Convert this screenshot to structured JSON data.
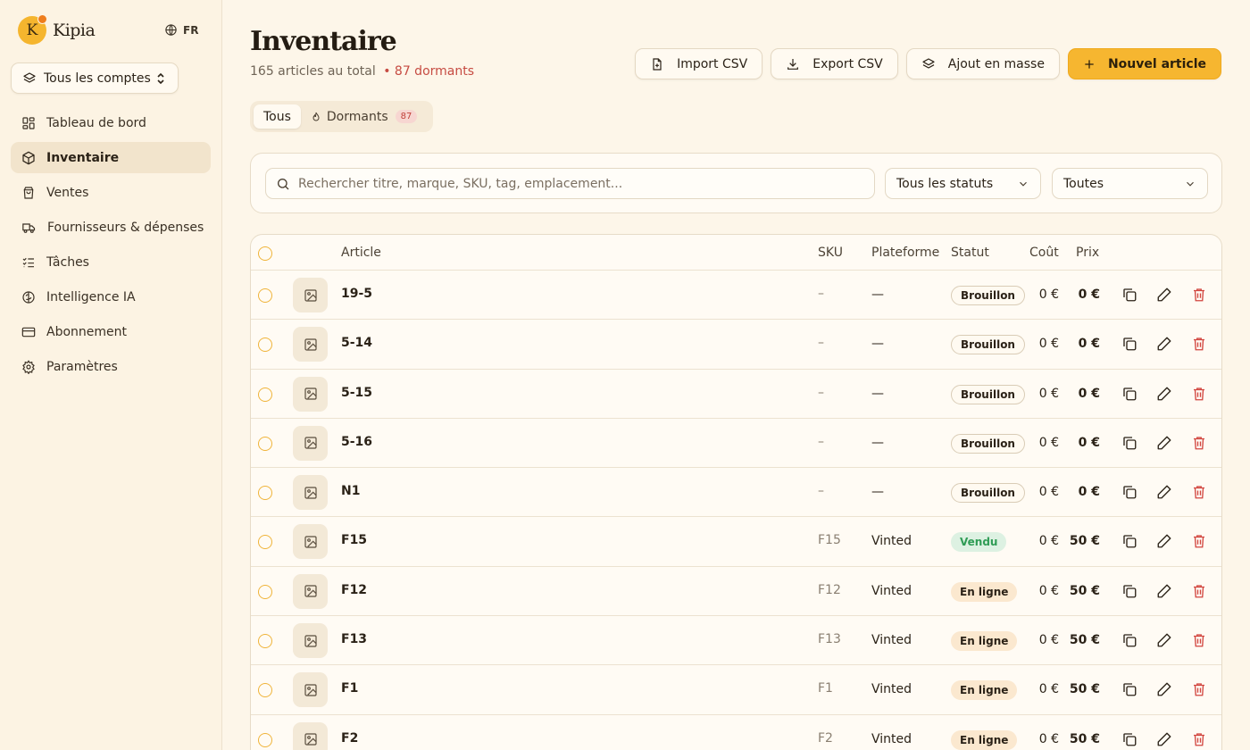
{
  "app": {
    "name": "Kipia",
    "logo_letter": "K",
    "language": "FR"
  },
  "account_selector": {
    "label": "Tous les comptes"
  },
  "sidebar": {
    "items": [
      {
        "label": "Tableau de bord",
        "icon": "dashboard-icon",
        "active": false
      },
      {
        "label": "Inventaire",
        "icon": "box-icon",
        "active": true
      },
      {
        "label": "Ventes",
        "icon": "shopping-bag-icon",
        "active": false
      },
      {
        "label": "Fournisseurs & dépenses",
        "icon": "truck-icon",
        "active": false
      },
      {
        "label": "Tâches",
        "icon": "checklist-icon",
        "active": false
      },
      {
        "label": "Intelligence IA",
        "icon": "brain-icon",
        "active": false
      },
      {
        "label": "Abonnement",
        "icon": "credit-card-icon",
        "active": false
      },
      {
        "label": "Paramètres",
        "icon": "gear-icon",
        "active": false
      }
    ]
  },
  "header": {
    "title": "Inventaire",
    "total_text": "165 articles au total",
    "dormant_text": "• 87 dormants"
  },
  "actions": {
    "import": "Import CSV",
    "export": "Export CSV",
    "bulk": "Ajout en masse",
    "new": "Nouvel article"
  },
  "tabs": [
    {
      "label": "Tous",
      "active": true
    },
    {
      "label": "Dormants",
      "count": "87",
      "active": false
    }
  ],
  "filters": {
    "search_placeholder": "Rechercher titre, marque, SKU, tag, emplacement...",
    "status_select": "Tous les statuts",
    "category_select": "Toutes"
  },
  "table": {
    "columns": [
      "Article",
      "SKU",
      "Plateforme",
      "Statut",
      "Coût",
      "Prix"
    ],
    "rows": [
      {
        "title": "19-5",
        "sku": "–",
        "platform": "—",
        "status": "Brouillon",
        "status_type": "draft",
        "cost": "0 €",
        "price": "0 €"
      },
      {
        "title": "5-14",
        "sku": "–",
        "platform": "—",
        "status": "Brouillon",
        "status_type": "draft",
        "cost": "0 €",
        "price": "0 €"
      },
      {
        "title": "5-15",
        "sku": "–",
        "platform": "—",
        "status": "Brouillon",
        "status_type": "draft",
        "cost": "0 €",
        "price": "0 €"
      },
      {
        "title": "5-16",
        "sku": "–",
        "platform": "—",
        "status": "Brouillon",
        "status_type": "draft",
        "cost": "0 €",
        "price": "0 €"
      },
      {
        "title": "N1",
        "sku": "–",
        "platform": "—",
        "status": "Brouillon",
        "status_type": "draft",
        "cost": "0 €",
        "price": "0 €"
      },
      {
        "title": "F15",
        "sku": "F15",
        "platform": "Vinted",
        "status": "Vendu",
        "status_type": "sold",
        "cost": "0 €",
        "price": "50 €"
      },
      {
        "title": "F12",
        "sku": "F12",
        "platform": "Vinted",
        "status": "En ligne",
        "status_type": "online",
        "cost": "0 €",
        "price": "50 €"
      },
      {
        "title": "F13",
        "sku": "F13",
        "platform": "Vinted",
        "status": "En ligne",
        "status_type": "online",
        "cost": "0 €",
        "price": "50 €"
      },
      {
        "title": "F1",
        "sku": "F1",
        "platform": "Vinted",
        "status": "En ligne",
        "status_type": "online",
        "cost": "0 €",
        "price": "50 €"
      },
      {
        "title": "F2",
        "sku": "F2",
        "platform": "Vinted",
        "status": "En ligne",
        "status_type": "online",
        "cost": "0 €",
        "price": "50 €"
      }
    ]
  },
  "colors": {
    "accent": "#f6b630",
    "danger": "#d2463f",
    "success": "#2f9c55",
    "background": "#fdf6e9"
  }
}
